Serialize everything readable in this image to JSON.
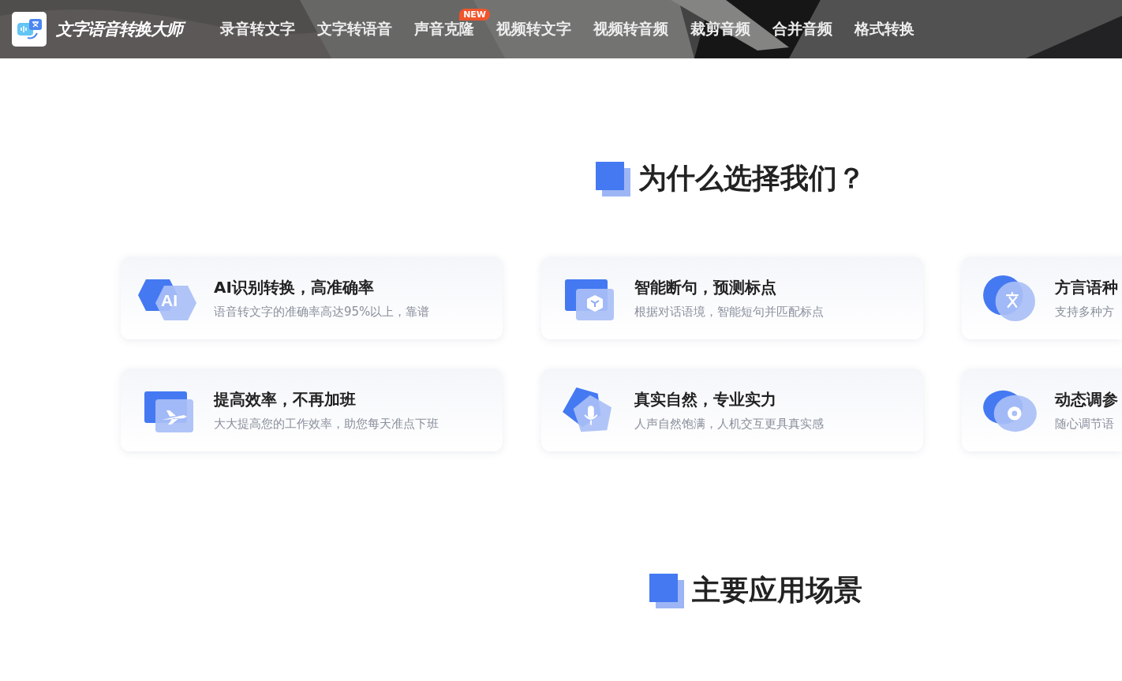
{
  "header": {
    "app_name": "文字语音转换大师",
    "nav": [
      {
        "label": "录音转文字"
      },
      {
        "label": "文字转语音"
      },
      {
        "label": "声音克隆",
        "badge": "NEW"
      },
      {
        "label": "视频转文字"
      },
      {
        "label": "视频转音频"
      },
      {
        "label": "裁剪音频"
      },
      {
        "label": "合并音频"
      },
      {
        "label": "格式转换"
      }
    ]
  },
  "why_section": {
    "title": "为什么选择我们？",
    "features": [
      {
        "kind": "ai",
        "icon_label": "AI",
        "title": "AI识别转换，高准确率",
        "description": "语音转文字的准确率高达95%以上，靠谱"
      },
      {
        "kind": "cube",
        "title": "智能断句，预测标点",
        "description": "根据对话语境，智能短句并匹配标点"
      },
      {
        "kind": "translate",
        "title": "方言语种",
        "description": "支持多种方"
      },
      {
        "kind": "plane",
        "title": "提高效率，不再加班",
        "description": "大大提高您的工作效率，助您每天准点下班"
      },
      {
        "kind": "mic",
        "title": "真实自然，专业实力",
        "description": "人声自然饱满，人机交互更具真实感"
      },
      {
        "kind": "gear",
        "title": "动态调参",
        "description": "随心调节语"
      }
    ]
  },
  "scenes_section": {
    "title": "主要应用场景"
  }
}
